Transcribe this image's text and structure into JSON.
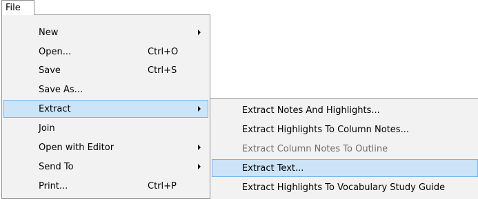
{
  "menubar": {
    "file_label": "File"
  },
  "file_menu": {
    "items": [
      {
        "label": "New",
        "shortcut": "",
        "submenu": true
      },
      {
        "label": "Open...",
        "shortcut": "Ctrl+O",
        "submenu": false
      },
      {
        "label": "Save",
        "shortcut": "Ctrl+S",
        "submenu": false
      },
      {
        "label": "Save As...",
        "shortcut": "",
        "submenu": false
      },
      {
        "label": "Extract",
        "shortcut": "",
        "submenu": true,
        "highlighted": true
      },
      {
        "label": "Join",
        "shortcut": "",
        "submenu": false
      },
      {
        "label": "Open with Editor",
        "shortcut": "",
        "submenu": true
      },
      {
        "label": "Send To",
        "shortcut": "",
        "submenu": true
      },
      {
        "label": "Print...",
        "shortcut": "Ctrl+P",
        "submenu": false
      }
    ]
  },
  "extract_submenu": {
    "items": [
      {
        "label": "Extract Notes And Highlights...",
        "enabled": true
      },
      {
        "label": "Extract Highlights To Column Notes...",
        "enabled": true
      },
      {
        "label": "Extract Column Notes To Outline",
        "enabled": false
      },
      {
        "label": "Extract Text...",
        "enabled": true,
        "highlighted": true
      },
      {
        "label": "Extract Highlights To Vocabulary Study Guide",
        "enabled": true
      }
    ]
  },
  "colors": {
    "highlight_fill": "#cce4f7",
    "highlight_border": "#7ab3e6",
    "menu_background": "#f2f2f2",
    "disabled_text": "#6d6d6d"
  }
}
